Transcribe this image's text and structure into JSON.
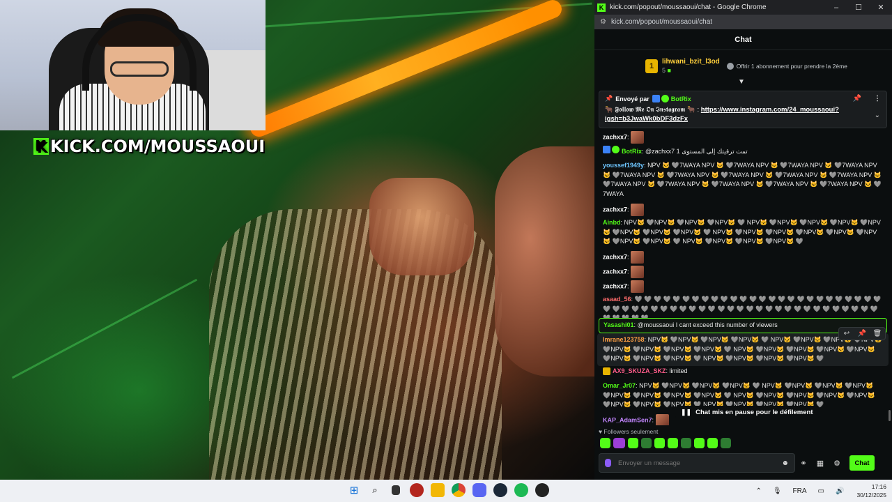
{
  "stream": {
    "brand_text": "KICK.COM/MOUSSAOUI",
    "brand_k": "K"
  },
  "window": {
    "title": "kick.com/popout/moussaoui/chat - Google Chrome",
    "address": "kick.com/popout/moussaoui/chat",
    "minimize": "–",
    "maximize": "☐",
    "close": "✕"
  },
  "chat": {
    "header": "Chat",
    "sub_banner": {
      "rank": "1",
      "user": "lihwani_bzit_l3od",
      "count": "5",
      "offer": "Offrir 1 abonnement pour prendre la 2ème"
    },
    "pinned": {
      "prefix": "Envoyé par",
      "bot": "BotRix",
      "text_pre": "🐂 𝕱𝖔𝖑𝖑𝖔𝖜 𝕸𝖊 𝕺𝖓 𝕴𝖓𝖘𝖙𝖆𝖌𝖗𝖆𝖒 🐂 : ",
      "link": "https://www.instagram.com/24_moussaoui?igsh=b3JwaWk0bDF3dzFx"
    },
    "messages": [
      {
        "user": "zachxx7",
        "color": "#ffffff",
        "text": "",
        "emote": true
      },
      {
        "user": "BotRix",
        "color": "#53fc18",
        "text": "@zachxx7 تمت ترقيتك إلى المستوى 1",
        "bot": true
      },
      {
        "user": "youssef1949y",
        "color": "#6ec6ff",
        "text": "NPV 🐱 🩶7WAYA NPV 🐱 🩶7WAYA NPV 🐱 🩶7WAYA NPV 🐱 🩶7WAYA NPV 🐱 🩶7WAYA NPV 🐱 🩶7WAYA NPV 🐱 🩶7WAYA NPV 🐱 🩶7WAYA NPV 🐱 🩶7WAYA NPV 🐱 🩶7WAYA NPV 🐱 🩶7WAYA NPV 🐱 🩶7WAYA NPV 🐱 🩶7WAYA NPV 🐱 🩶7WAYA NPV 🐱 🩶7WAYA"
      },
      {
        "user": "zachxx7",
        "color": "#ffffff",
        "text": "",
        "emote": true
      },
      {
        "user": "Ainbd",
        "color": "#53fc18",
        "text": "NPV🐱 🩶NPV🐱 🩶NPV🐱 🩶NPV🐱 🩶 NPV🐱 🩶NPV🐱 🩶NPV🐱 🩶NPV🐱 🩶NPV🐱 🩶NPV🐱 🩶NPV🐱 🩶NPV🐱 🩶 NPV🐱 🩶NPV🐱 🩶NPV🐱 🩶NPV🐱 🩶NPV🐱 🩶NPV🐱 🩶NPV🐱 🩶NPV🐱 🩶 NPV🐱 🩶NPV🐱 🩶NPV🐱 🩶NPV🐱 🩶"
      },
      {
        "user": "zachxx7",
        "color": "#ffffff",
        "text": "",
        "emote": true
      },
      {
        "user": "zachxx7",
        "color": "#ffffff",
        "text": "",
        "emote": true
      },
      {
        "user": "zachxx7",
        "color": "#ffffff",
        "text": "",
        "emote": true
      },
      {
        "user": "asaad_56",
        "color": "#ff6b6b",
        "text": "🩶 🩶 🩶 🩶 🩶 🩶 🩶 🩶 🩶 🩶 🩶 🩶 🩶 🩶 🩶 🩶 🩶 🩶 🩶 🩶 🩶 🩶 🩶 🩶 🩶 🩶 🩶 🩶 🩶 🩶 🩶 🩶 🩶 🩶 🩶 🩶 🩶 🩶 🩶 🩶 🩶 🩶 🩶 🩶 🩶 🩶 🩶 🩶 🩶 🩶 🩶 🩶 🩶 🩶 🩶 🩶 🩶 🩶 🩶 🩶"
      },
      {
        "user": "Yasashi01",
        "color": "#53fc18",
        "text": "@moussaoui I cant exceed this number of viewers",
        "highlight": true
      },
      {
        "user": "Imrane123758",
        "color": "#ff9f43",
        "text": "NPV🐱 🩶NPV🐱 🩶NPV🐱 🩶NPV🐱 🩶 NPV🐱 🩶NPV🐱 🩶NPV🐱 🩶NPV🐱 🩶NPV🐱 🩶NPV🐱 🩶NPV🐱 🩶NPV🐱 🩶 NPV🐱 🩶NPV🐱 🩶NPV🐱 🩶NPV🐱 🩶NPV🐱 🩶NPV🐱 🩶NPV🐱 🩶NPV🐱 🩶 NPV🐱 🩶NPV🐱 🩶NPV🐱 🩶NPV🐱 🩶",
        "hover": true
      },
      {
        "user": "AX9_SKUZA_SKZ",
        "color": "#ff5c8a",
        "text": "limited",
        "crown": true
      },
      {
        "user": "Omar_Jr07",
        "color": "#53fc18",
        "text": "NPV🐱 🩶NPV🐱 🩶NPV🐱 🩶NPV🐱 🩶 NPV🐱 🩶NPV🐱 🩶NPV🐱 🩶NPV🐱 🩶NPV🐱 🩶NPV🐱 🩶NPV🐱 🩶NPV🐱 🩶 NPV🐱 🩶NPV🐱 🩶NPV🐱 🩶NPV🐱 🩶NPV🐱 🩶NPV🐱 🩶NPV🐱 🩶NPV🐱 🩶 NPV🐱 🩶NPV🐱 🩶NPV🐱 🩶NPV🐱 🩶"
      },
      {
        "user": "KAP_AdamSen7",
        "color": "#c084fc",
        "text": "",
        "emote": true
      }
    ],
    "paused_label": "Chat mis en pause pour le défilement",
    "followers_only": "Followers seulement",
    "input_placeholder": "Envoyer un message",
    "send_label": "Chat"
  },
  "taskbar": {
    "lang": "FRA",
    "time": "17:16",
    "date": "30/12/2025"
  },
  "colors": {
    "accent": "#53fc18",
    "chat_bg": "#0b0e0f"
  }
}
